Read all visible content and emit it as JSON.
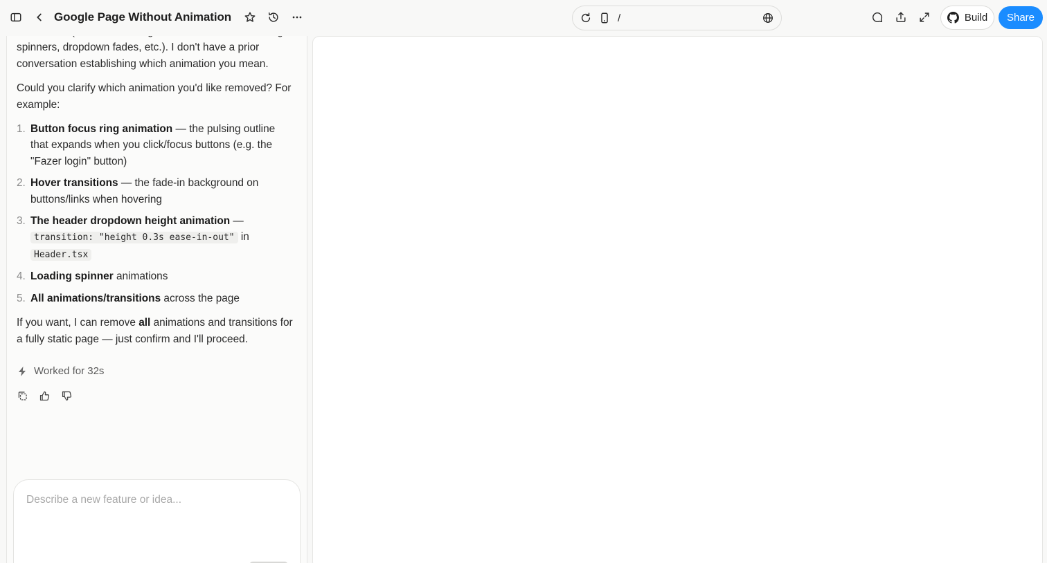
{
  "header": {
    "title": "Google Page Without Animation",
    "url_path": "/",
    "build_label": "Build",
    "share_label": "Share",
    "share_color": "#1a8cff",
    "icons": [
      "sidebar-toggle-icon",
      "chevron-left-icon",
      "star-icon",
      "history-icon",
      "more-icon",
      "reload-icon",
      "mobile-icon",
      "globe-icon",
      "comment-icon",
      "upload-icon",
      "expand-icon",
      "github-icon"
    ]
  },
  "chat": {
    "intro_fragment": "animations (button focus rings, hover transitions, loading spinners, dropdown fades, etc.). I don't have a prior conversation establishing which animation you mean.",
    "question": "Could you clarify which animation you'd like removed? For example:",
    "options": [
      {
        "num": "1.",
        "bold": "Button focus ring animation",
        "rest": " — the pulsing outline that expands when you click/focus buttons (e.g. the \"Fazer login\" button)"
      },
      {
        "num": "2.",
        "bold": "Hover transitions",
        "rest": " — the fade-in background on buttons/links when hovering"
      },
      {
        "num": "3.",
        "bold": "The header dropdown height animation",
        "rest": " —",
        "code1": "transition: \"height 0.3s ease-in-out\"",
        "mid": " in",
        "code2": "Header.tsx"
      },
      {
        "num": "4.",
        "bold": "Loading spinner",
        "rest": " animations"
      },
      {
        "num": "5.",
        "bold": "All animations/transitions",
        "rest": " across the page"
      }
    ],
    "closing_pre": "If you want, I can remove ",
    "closing_bold": "all",
    "closing_post": " animations and transitions for a fully static page — just confirm and I'll proceed.",
    "worked_label": "Worked for 32s"
  },
  "composer": {
    "placeholder": "Describe a new feature or idea..."
  }
}
